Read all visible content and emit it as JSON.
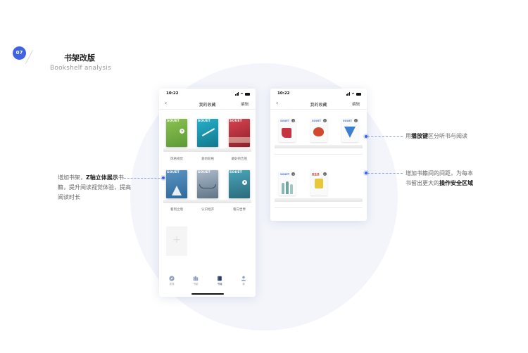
{
  "header": {
    "step_number": "07",
    "title": "书架改版",
    "subtitle": "Bookshelf analysis"
  },
  "phone_left": {
    "time": "10:22",
    "nav_title": "我的收藏",
    "edit_label": "编辑",
    "books": [
      {
        "mag": "SOUET",
        "label": "风格视觉",
        "color": "#7ab548"
      },
      {
        "mag": "SOUET",
        "label": "爱的轮格",
        "color": "#1f9ab3"
      },
      {
        "mag": "SOUET",
        "label": "最好的告别",
        "color": "#b0303b"
      },
      {
        "mag": "SOUET",
        "label": "看到之境",
        "color": "#4f8ab3"
      },
      {
        "mag": "SOUET",
        "label": "认识经济",
        "color": "#7d9bb5"
      },
      {
        "mag": "SOUET",
        "label": "看向世界",
        "color": "#3e8fa3"
      }
    ],
    "tabs": [
      {
        "label": "发现",
        "icon": "compass-icon"
      },
      {
        "label": "书架",
        "icon": "bookshelf-icon"
      },
      {
        "label": "书城",
        "icon": "book-icon"
      },
      {
        "label": "我",
        "icon": "user-icon"
      }
    ],
    "active_tab": "书城"
  },
  "phone_right": {
    "time": "10:22",
    "nav_title": "我的收藏",
    "edit_label": "编辑",
    "covers_row1": [
      "SOUET",
      "SOUET",
      "SOUET"
    ],
    "covers_row2": [
      "SOUET",
      "爱生活"
    ]
  },
  "notes": {
    "left_plain_1": "增加书架，",
    "left_bold": "Z轴立体展示",
    "left_plain_2": "书籍，提升阅读视觉体验，提高阅读时长",
    "right_top_plain_1": "用",
    "right_top_bold": "播放键",
    "right_top_plain_2": "区分听书与阅读",
    "right_bottom_plain_1": "增加书籍间的间距，为每本书留出更大的",
    "right_bottom_bold": "操作安全区域"
  },
  "colors": {
    "accent": "#3e63e4",
    "background_circle": "#f3f5fb"
  }
}
